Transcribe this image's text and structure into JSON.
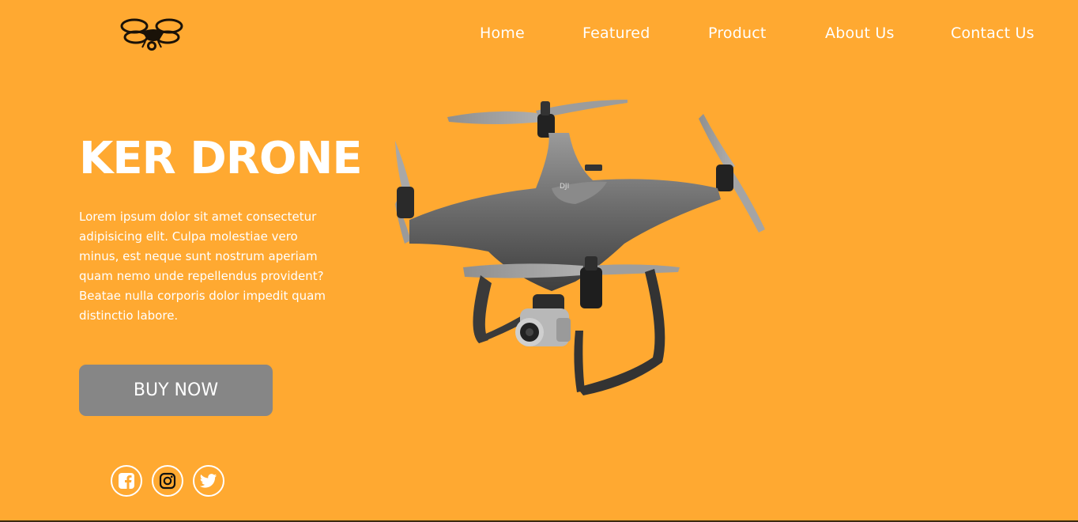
{
  "brand": {
    "logo_icon": "drone-logo-icon"
  },
  "nav": {
    "items": [
      {
        "label": "Home"
      },
      {
        "label": "Featured"
      },
      {
        "label": "Product"
      },
      {
        "label": "About Us"
      },
      {
        "label": "Contact Us"
      }
    ]
  },
  "hero": {
    "title": "KER DRONE",
    "description": "Lorem ipsum dolor sit amet consectetur adipisicing elit. Culpa molestiae vero minus, est neque sunt nostrum aperiam quam nemo unde repellendus provident? Beatae nulla corporis dolor impedit quam distinctio labore.",
    "cta_label": "BUY NOW",
    "image_icon": "drone-image"
  },
  "social": {
    "items": [
      {
        "icon": "facebook-icon"
      },
      {
        "icon": "instagram-icon"
      },
      {
        "icon": "twitter-icon"
      }
    ]
  },
  "colors": {
    "background": "#ffa931",
    "button": "#868686",
    "text": "#ffffff"
  }
}
